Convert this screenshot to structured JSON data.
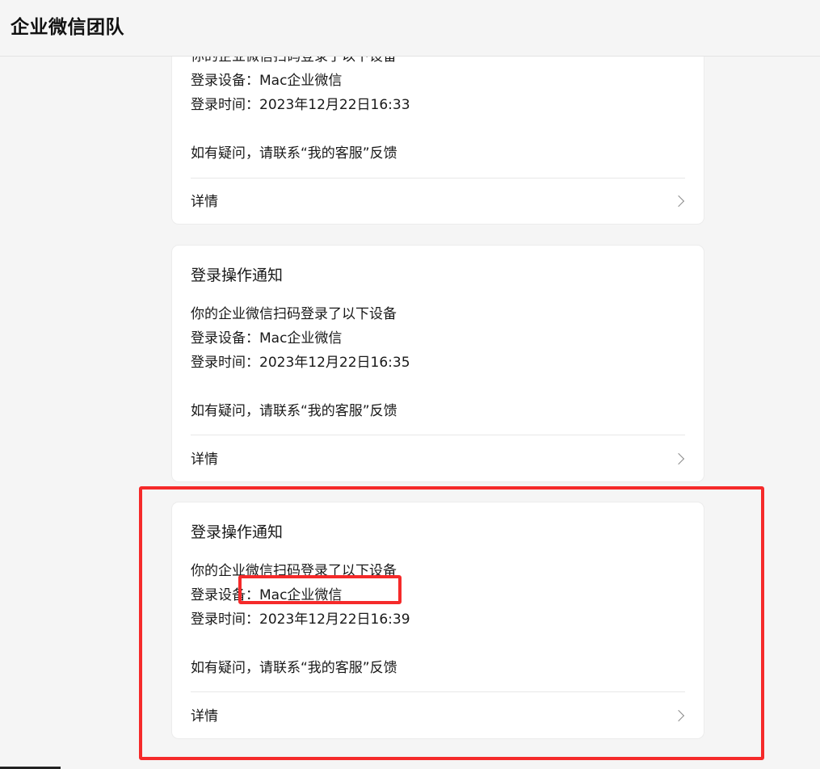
{
  "header": {
    "title": "企业微信团队"
  },
  "cards": [
    {
      "line_top_partial": "你的企业微信扫码登录了以下设备",
      "device": "登录设备：Mac企业微信",
      "time": "登录时间：2023年12月22日16:33",
      "contact": "如有疑问，请联系“我的客服”反馈",
      "detail": "详情"
    },
    {
      "title": "登录操作通知",
      "intro": "你的企业微信扫码登录了以下设备",
      "device": "登录设备：Mac企业微信",
      "time": "登录时间：2023年12月22日16:35",
      "contact": "如有疑问，请联系“我的客服”反馈",
      "detail": "详情"
    },
    {
      "title": "登录操作通知",
      "intro": "你的企业微信扫码登录了以下设备",
      "device": "登录设备：Mac企业微信",
      "time": "登录时间：2023年12月22日16:39",
      "contact": "如有疑问，请联系“我的客服”反馈",
      "detail": "详情"
    }
  ],
  "icons": {
    "detail_chevron": "chevron-right-icon"
  },
  "colors": {
    "highlight": "#f52a2a",
    "card_bg": "#ffffff",
    "page_bg": "#f5f5f5"
  }
}
